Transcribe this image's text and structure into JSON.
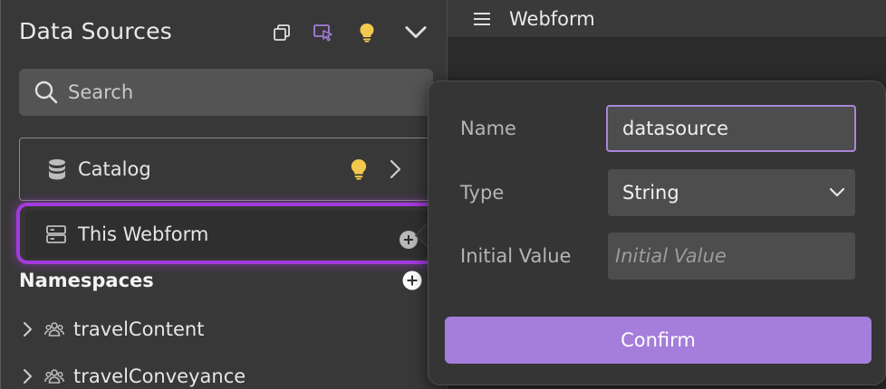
{
  "panel": {
    "title": "Data Sources",
    "header_icons": [
      "copy-icon",
      "cursor-select-icon",
      "lightbulb-icon",
      "chevron-down-icon"
    ],
    "search": {
      "placeholder": "Search"
    },
    "catalog": {
      "label": "Catalog"
    },
    "this_webform": {
      "label": "This Webform"
    },
    "namespaces": {
      "title": "Namespaces",
      "items": [
        {
          "label": "travelContent"
        },
        {
          "label": "travelConveyance"
        }
      ]
    }
  },
  "topbar": {
    "title": "Webform"
  },
  "popover": {
    "name_label": "Name",
    "name_value": "datasource",
    "type_label": "Type",
    "type_value": "String",
    "initial_label": "Initial Value",
    "initial_placeholder": "Initial Value",
    "confirm_label": "Confirm"
  },
  "colors": {
    "accent_purple": "#a57ddb",
    "highlight_border": "#a43bdc",
    "bulb_yellow": "#f2c94c"
  }
}
